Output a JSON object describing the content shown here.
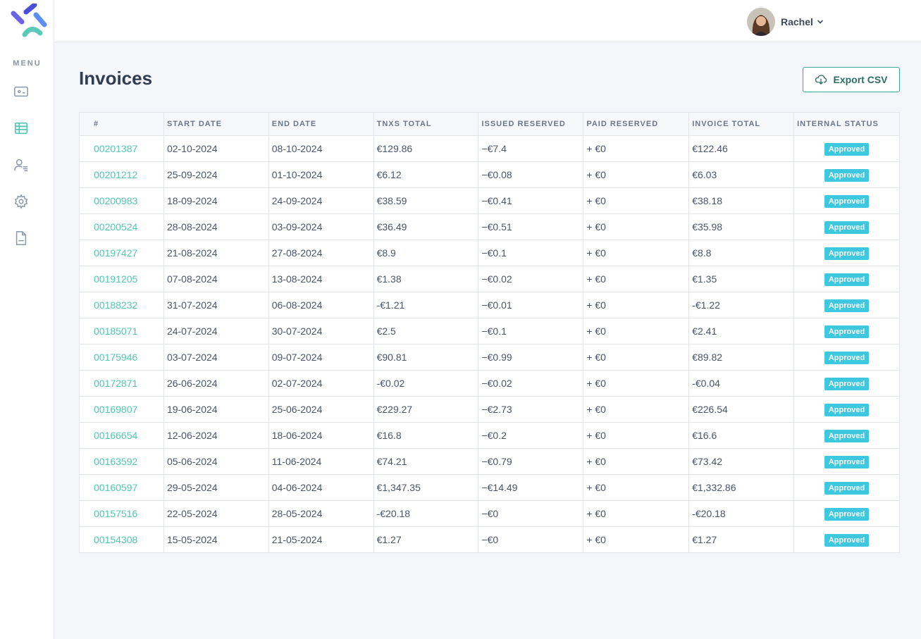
{
  "sidebar": {
    "menu_label": "MENU",
    "items": [
      {
        "name": "wallet-icon",
        "active": false
      },
      {
        "name": "table-icon",
        "active": true
      },
      {
        "name": "user-list-icon",
        "active": false
      },
      {
        "name": "gear-icon",
        "active": false
      },
      {
        "name": "document-icon",
        "active": false
      }
    ]
  },
  "header": {
    "user_name": "Rachel"
  },
  "main": {
    "title": "Invoices",
    "export_label": "Export CSV",
    "columns": [
      "#",
      "START DATE",
      "END DATE",
      "TNXS TOTAL",
      "ISSUED RESERVED",
      "PAID RESERVED",
      "INVOICE TOTAL",
      "INTERNAL STATUS"
    ],
    "rows": [
      {
        "id": "00201387",
        "start": "02-10-2024",
        "end": "08-10-2024",
        "tnxs": "€129.86",
        "issued": "−€7.4",
        "paid": "+ €0",
        "total": "€122.46",
        "status": "Approved"
      },
      {
        "id": "00201212",
        "start": "25-09-2024",
        "end": "01-10-2024",
        "tnxs": "€6.12",
        "issued": "−€0.08",
        "paid": "+ €0",
        "total": "€6.03",
        "status": "Approved"
      },
      {
        "id": "00200983",
        "start": "18-09-2024",
        "end": "24-09-2024",
        "tnxs": "€38.59",
        "issued": "−€0.41",
        "paid": "+ €0",
        "total": "€38.18",
        "status": "Approved"
      },
      {
        "id": "00200524",
        "start": "28-08-2024",
        "end": "03-09-2024",
        "tnxs": "€36.49",
        "issued": "−€0.51",
        "paid": "+ €0",
        "total": "€35.98",
        "status": "Approved"
      },
      {
        "id": "00197427",
        "start": "21-08-2024",
        "end": "27-08-2024",
        "tnxs": "€8.9",
        "issued": "−€0.1",
        "paid": "+ €0",
        "total": "€8.8",
        "status": "Approved"
      },
      {
        "id": "00191205",
        "start": "07-08-2024",
        "end": "13-08-2024",
        "tnxs": "€1.38",
        "issued": "−€0.02",
        "paid": "+ €0",
        "total": "€1.35",
        "status": "Approved"
      },
      {
        "id": "00188232",
        "start": "31-07-2024",
        "end": "06-08-2024",
        "tnxs": "-€1.21",
        "issued": "−€0.01",
        "paid": "+ €0",
        "total": "-€1.22",
        "status": "Approved"
      },
      {
        "id": "00185071",
        "start": "24-07-2024",
        "end": "30-07-2024",
        "tnxs": "€2.5",
        "issued": "−€0.1",
        "paid": "+ €0",
        "total": "€2.41",
        "status": "Approved"
      },
      {
        "id": "00175946",
        "start": "03-07-2024",
        "end": "09-07-2024",
        "tnxs": "€90.81",
        "issued": "−€0.99",
        "paid": "+ €0",
        "total": "€89.82",
        "status": "Approved"
      },
      {
        "id": "00172871",
        "start": "26-06-2024",
        "end": "02-07-2024",
        "tnxs": "-€0.02",
        "issued": "−€0.02",
        "paid": "+ €0",
        "total": "-€0.04",
        "status": "Approved"
      },
      {
        "id": "00169807",
        "start": "19-06-2024",
        "end": "25-06-2024",
        "tnxs": "€229.27",
        "issued": "−€2.73",
        "paid": "+ €0",
        "total": "€226.54",
        "status": "Approved"
      },
      {
        "id": "00166654",
        "start": "12-06-2024",
        "end": "18-06-2024",
        "tnxs": "€16.8",
        "issued": "−€0.2",
        "paid": "+ €0",
        "total": "€16.6",
        "status": "Approved"
      },
      {
        "id": "00163592",
        "start": "05-06-2024",
        "end": "11-06-2024",
        "tnxs": "€74.21",
        "issued": "−€0.79",
        "paid": "+ €0",
        "total": "€73.42",
        "status": "Approved"
      },
      {
        "id": "00160597",
        "start": "29-05-2024",
        "end": "04-06-2024",
        "tnxs": "€1,347.35",
        "issued": "−€14.49",
        "paid": "+ €0",
        "total": "€1,332.86",
        "status": "Approved"
      },
      {
        "id": "00157516",
        "start": "22-05-2024",
        "end": "28-05-2024",
        "tnxs": "-€20.18",
        "issued": "−€0",
        "paid": "+ €0",
        "total": "-€20.18",
        "status": "Approved"
      },
      {
        "id": "00154308",
        "start": "15-05-2024",
        "end": "21-05-2024",
        "tnxs": "€1.27",
        "issued": "−€0",
        "paid": "+ €0",
        "total": "€1.27",
        "status": "Approved"
      }
    ]
  },
  "colors": {
    "accent": "#4fc8b3",
    "badge": "#3ec8e0",
    "export_border": "#3aa996",
    "nav_icon": "#8a96aa",
    "nav_icon_active": "#4fc8b3"
  }
}
